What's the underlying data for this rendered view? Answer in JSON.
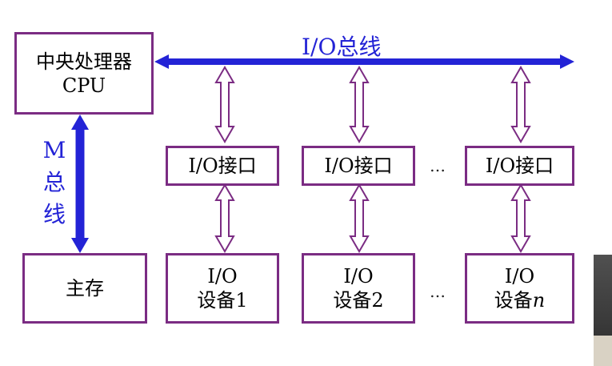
{
  "colors": {
    "box_border": "#7b2c83",
    "bus_fill": "#2323d6",
    "hollow_arrow": "#7b2c83",
    "label_blue": "#2323d6"
  },
  "cpu": {
    "line1": "中央处理器",
    "line2": "CPU"
  },
  "memory": {
    "label": "主存"
  },
  "io_bus": {
    "label": "I/O总线"
  },
  "m_bus": {
    "chars": [
      "M",
      "总",
      "线"
    ]
  },
  "interfaces": [
    {
      "label": "I/O接口"
    },
    {
      "label": "I/O接口"
    },
    {
      "label": "I/O接口"
    }
  ],
  "devices": [
    {
      "line1": "I/O",
      "line2": "设备1"
    },
    {
      "line1": "I/O",
      "line2": "设备2"
    },
    {
      "line1": "I/O",
      "line2_prefix": "设备",
      "line2_italic": "n"
    }
  ],
  "ellipsis": "…"
}
